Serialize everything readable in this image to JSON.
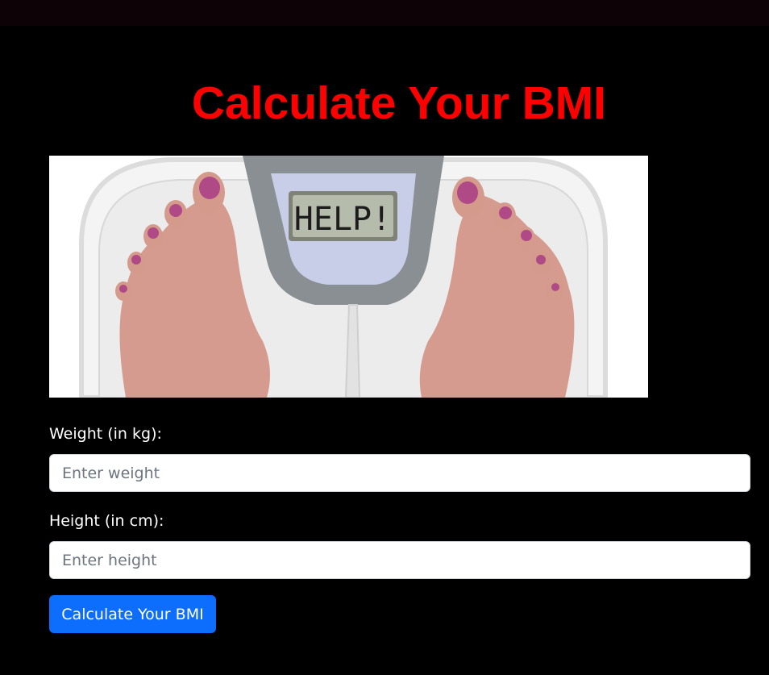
{
  "page": {
    "title": "Calculate Your BMI"
  },
  "hero": {
    "display_text": "HELP!"
  },
  "form": {
    "weight": {
      "label": "Weight (in kg):",
      "placeholder": "Enter weight"
    },
    "height": {
      "label": "Height (in cm):",
      "placeholder": "Enter height"
    },
    "submit_label": "Calculate Your BMI"
  },
  "colors": {
    "background": "#000000",
    "title": "#ff0000",
    "button": "#0d6efd"
  }
}
